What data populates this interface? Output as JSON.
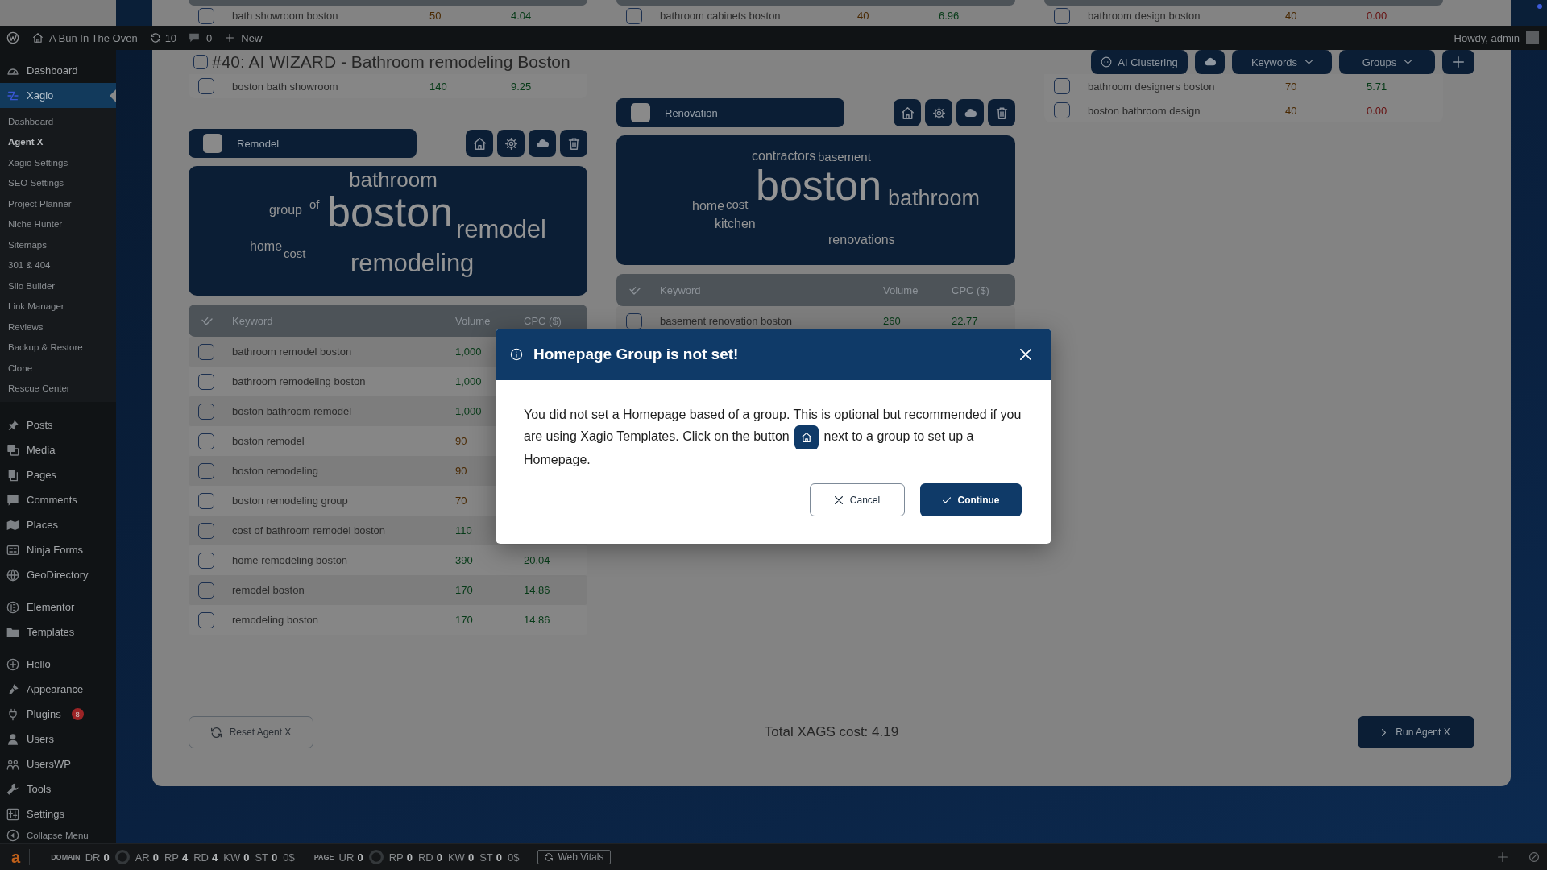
{
  "top_strip": {
    "rows": [
      {
        "checked": false,
        "keyword": "bath showroom boston",
        "volume": {
          "text": "50",
          "color": "#4a2902"
        },
        "cpc": {
          "text": "4.04",
          "color": "#063a17"
        }
      },
      {
        "checked": false,
        "keyword": "bathroom cabinets boston",
        "volume": {
          "text": "40",
          "color": "#4a2902"
        },
        "cpc": {
          "text": "6.96",
          "color": "#063a17"
        }
      },
      {
        "checked": false,
        "keyword": "bathroom design boston",
        "volume": {
          "text": "40",
          "color": "#4a2902"
        },
        "cpc": {
          "text": "0.00",
          "color": "#661010"
        }
      }
    ]
  },
  "admin_bar": {
    "site_name": "A Bun In The Oven",
    "updates": "10",
    "comments": "0",
    "new_label": "New",
    "greeting": "Howdy, admin"
  },
  "sidebar": {
    "sections": [
      {
        "items": [
          {
            "label": "Dashboard",
            "selected": false
          },
          {
            "label": "Xagio",
            "selected": true,
            "children": [
              {
                "label": "Dashboard",
                "selected": false
              },
              {
                "label": "Agent X",
                "selected": true
              },
              {
                "label": "Xagio Settings",
                "selected": false
              },
              {
                "label": "SEO Settings",
                "selected": false
              },
              {
                "label": "Project Planner",
                "selected": false
              },
              {
                "label": "Niche Hunter",
                "selected": false
              },
              {
                "label": "Sitemaps",
                "selected": false
              },
              {
                "label": "301 & 404",
                "selected": false
              },
              {
                "label": "Silo Builder",
                "selected": false
              },
              {
                "label": "Link Manager",
                "selected": false
              },
              {
                "label": "Reviews",
                "selected": false
              },
              {
                "label": "Backup & Restore",
                "selected": false
              },
              {
                "label": "Clone",
                "selected": false
              },
              {
                "label": "Rescue Center",
                "selected": false
              }
            ]
          }
        ]
      },
      {
        "items": [
          {
            "label": "Posts",
            "selected": false
          },
          {
            "label": "Media",
            "selected": false
          },
          {
            "label": "Pages",
            "selected": false
          },
          {
            "label": "Comments",
            "selected": false
          },
          {
            "label": "Places",
            "selected": false
          },
          {
            "label": "Ninja Forms",
            "selected": false
          },
          {
            "label": "GeoDirectory",
            "selected": false
          }
        ]
      },
      {
        "items": [
          {
            "label": "Elementor",
            "selected": false
          },
          {
            "label": "Templates",
            "selected": false
          }
        ]
      },
      {
        "items": [
          {
            "label": "Hello",
            "selected": false
          },
          {
            "label": "Appearance",
            "selected": false
          },
          {
            "label": "Plugins",
            "selected": false,
            "badge": "8"
          },
          {
            "label": "Users",
            "selected": false
          },
          {
            "label": "UsersWP",
            "selected": false
          },
          {
            "label": "Tools",
            "selected": false
          },
          {
            "label": "Settings",
            "selected": false
          }
        ]
      }
    ],
    "collapse_label": "Collapse Menu"
  },
  "header": {
    "checked": false,
    "title": "#40: AI WIZARD - Bathroom remodeling Boston",
    "tools": [
      {
        "kind": "ai",
        "label": "AI Clustering"
      },
      {
        "kind": "cloud"
      },
      {
        "kind": "dropdown",
        "label": "Keywords"
      },
      {
        "kind": "dropdown",
        "label": "Groups"
      },
      {
        "kind": "add"
      }
    ]
  },
  "columns": [
    {
      "rows": [
        {
          "checked": false,
          "keyword": "boston bath showroom",
          "volume": {
            "text": "140",
            "color": "#063a17"
          },
          "cpc": {
            "text": "9.25",
            "color": "#063a17"
          }
        }
      ],
      "groups": [
        {
          "name": "Remodel",
          "checked": false,
          "words": [
            "bathroom",
            "group",
            "of",
            "boston",
            "remodel",
            "home",
            "cost",
            "remodeling"
          ],
          "table": {
            "columns": [
              "Keyword",
              "Volume",
              "CPC ($)"
            ],
            "rows": [
              {
                "checked": false,
                "keyword": "bathroom remodel boston",
                "volume": {
                  "text": "1,000",
                  "color": "#063a17"
                }
              },
              {
                "checked": false,
                "keyword": "bathroom remodeling boston",
                "volume": {
                  "text": "1,000",
                  "color": "#063a17"
                }
              },
              {
                "checked": false,
                "keyword": "boston bathroom remodel",
                "volume": {
                  "text": "1,000",
                  "color": "#063a17"
                }
              },
              {
                "checked": false,
                "keyword": "boston remodel",
                "volume": {
                  "text": "90",
                  "color": "#4a2902"
                }
              },
              {
                "checked": false,
                "keyword": "boston remodeling",
                "volume": {
                  "text": "90",
                  "color": "#4a2902"
                }
              },
              {
                "checked": false,
                "keyword": "boston remodeling group",
                "volume": {
                  "text": "70",
                  "color": "#4a2902"
                }
              },
              {
                "checked": false,
                "keyword": "cost of bathroom remodel boston",
                "volume": {
                  "text": "110",
                  "color": "#063a17"
                }
              },
              {
                "checked": false,
                "keyword": "home remodeling boston",
                "volume": {
                  "text": "390",
                  "color": "#063a17"
                },
                "cpc": {
                  "text": "20.04",
                  "color": "#063a17"
                }
              },
              {
                "checked": false,
                "keyword": "remodel boston",
                "volume": {
                  "text": "170",
                  "color": "#063a17"
                },
                "cpc": {
                  "text": "14.86",
                  "color": "#063a17"
                }
              },
              {
                "checked": false,
                "keyword": "remodeling boston",
                "volume": {
                  "text": "170",
                  "color": "#063a17"
                },
                "cpc": {
                  "text": "14.86",
                  "color": "#063a17"
                }
              }
            ]
          }
        }
      ]
    },
    {
      "groups": [
        {
          "name": "Renovation",
          "checked": false,
          "words": [
            "contractors",
            "basement",
            "boston",
            "bathroom",
            "home",
            "cost",
            "kitchen",
            "renovations"
          ],
          "table": {
            "columns": [
              "Keyword",
              "Volume",
              "CPC ($)"
            ],
            "rows": [
              {
                "checked": false,
                "keyword": "basement renovation boston",
                "volume": {
                  "text": "260",
                  "color": "#063a17"
                },
                "cpc": {
                  "text": "22.77",
                  "color": "#063a17"
                }
              }
            ]
          }
        }
      ]
    },
    {
      "rows": [
        {
          "checked": false,
          "keyword": "bathroom designers boston",
          "volume": {
            "text": "70",
            "color": "#4a2902"
          },
          "cpc": {
            "text": "5.71",
            "color": "#063a17"
          }
        },
        {
          "checked": false,
          "keyword": "boston bathroom design",
          "volume": {
            "text": "40",
            "color": "#4a2902"
          },
          "cpc": {
            "text": "0.00",
            "color": "#661010"
          }
        }
      ]
    }
  ],
  "footer": {
    "reset_label": "Reset Agent X",
    "total": "Total XAGS cost: 4.19",
    "run_label": "Run Agent X"
  },
  "seo_bar": {
    "logo": "a",
    "sections": [
      {
        "label": "DOMAIN",
        "metrics": [
          {
            "name": "DR",
            "value": "0"
          },
          {
            "name": "AR",
            "value": "0"
          },
          {
            "name": "RP",
            "value": "4"
          },
          {
            "name": "RD",
            "value": "4"
          },
          {
            "name": "KW",
            "value": "0"
          },
          {
            "name": "ST",
            "value": "0"
          }
        ],
        "cost": "0$"
      },
      {
        "label": "PAGE",
        "metrics": [
          {
            "name": "UR",
            "value": "0"
          },
          {
            "name": "RP",
            "value": "0"
          },
          {
            "name": "RD",
            "value": "0"
          },
          {
            "name": "KW",
            "value": "0"
          },
          {
            "name": "ST",
            "value": "0"
          }
        ],
        "cost": "0$"
      }
    ],
    "vitals_label": "Web Vitals"
  },
  "dialog": {
    "title": "Homepage Group is not set!",
    "message_before": "You did not set a Homepage based of a group. This is optional but recommended if you are using Xagio Templates. Click on the button",
    "message_after": "next to a group to set up a Homepage.",
    "buttons": [
      {
        "kind": "cancel",
        "label": "Cancel"
      },
      {
        "kind": "confirm",
        "label": "Continue"
      }
    ]
  }
}
